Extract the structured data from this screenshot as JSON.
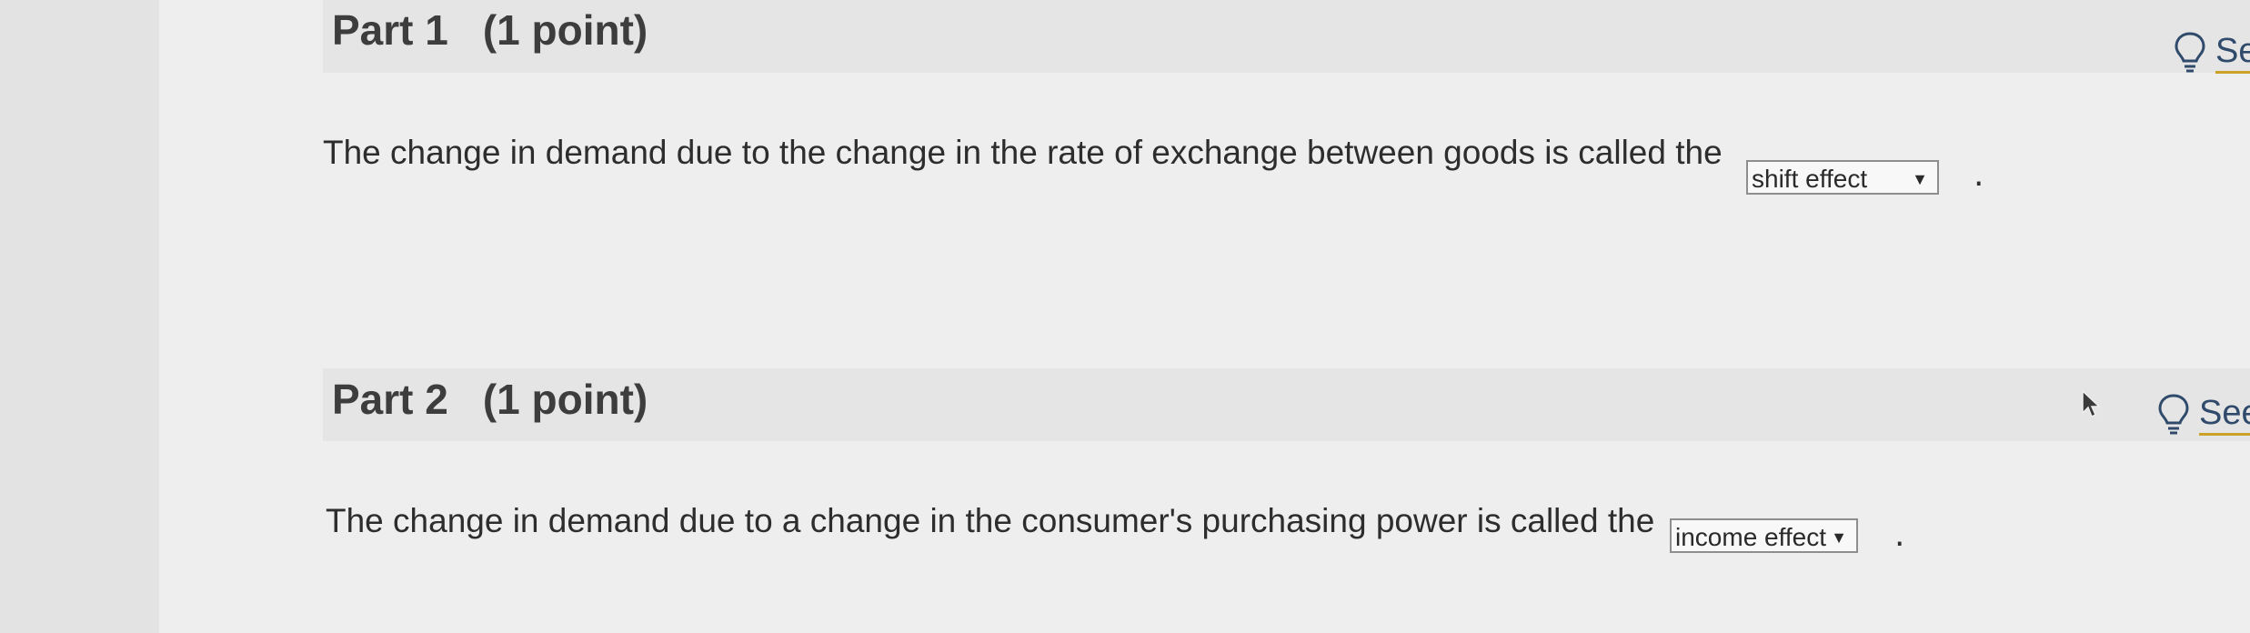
{
  "part1": {
    "title": "Part 1",
    "points": "(1 point)",
    "hint_label": "Se",
    "question": "The change in demand due to the change in the rate of exchange between goods is called the",
    "dropdown_value": "shift effect",
    "terminal": "."
  },
  "part2": {
    "title": "Part 2",
    "points": "(1 point)",
    "hint_label": "See",
    "question": "The change in demand due to a change in the consumer's purchasing power is called the",
    "dropdown_value": "income effect",
    "terminal": "."
  },
  "icons": {
    "hint": "lightbulb-icon",
    "dropdown_arrow": "triangle-down-icon",
    "cursor": "mouse-pointer-icon"
  },
  "colors": {
    "page_background": "#eeeeee",
    "header_background": "#e5e5e5",
    "hint_underline": "#c9a227",
    "hint_text": "#2f4a6a"
  }
}
